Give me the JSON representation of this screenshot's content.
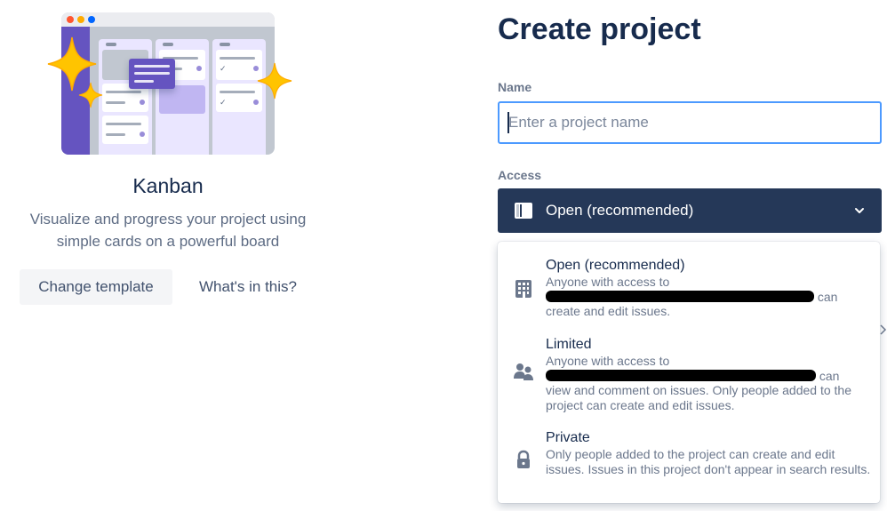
{
  "template": {
    "name": "Kanban",
    "description_line1": "Visualize and progress your project using",
    "description_line2": "simple cards on a powerful board",
    "change_button": "Change template",
    "whats_link": "What's in this?",
    "illustration_icons": [
      "sparkle-icon",
      "window-dots-icon"
    ]
  },
  "form": {
    "title": "Create project",
    "name_label": "Name",
    "name_placeholder": "Enter a project name",
    "name_value": "",
    "access_label": "Access",
    "access_selected": "Open (recommended)"
  },
  "access_menu": {
    "options": [
      {
        "title": "Open (recommended)",
        "desc_line1": "Anyone with access to",
        "desc_line2_tail": "can",
        "desc_rest": "create and edit issues.",
        "icon": "building-icon"
      },
      {
        "title": "Limited",
        "desc_line1": "Anyone with access to",
        "desc_line2_tail": "can",
        "desc_rest": "view and comment on issues. Only people added to the project can create and edit issues.",
        "icon": "people-icon"
      },
      {
        "title": "Private",
        "desc_rest": "Only people added to the project can create and edit issues. Issues in this project don't appear in search results.",
        "icon": "lock-icon"
      }
    ]
  },
  "colors": {
    "primary_text": "#172b4d",
    "secondary_text": "#6b778c",
    "focus_border": "#4c9aff",
    "select_bg": "#253858",
    "illustration_purple": "#6554c0",
    "sparkle_yellow": "#ffc400"
  }
}
